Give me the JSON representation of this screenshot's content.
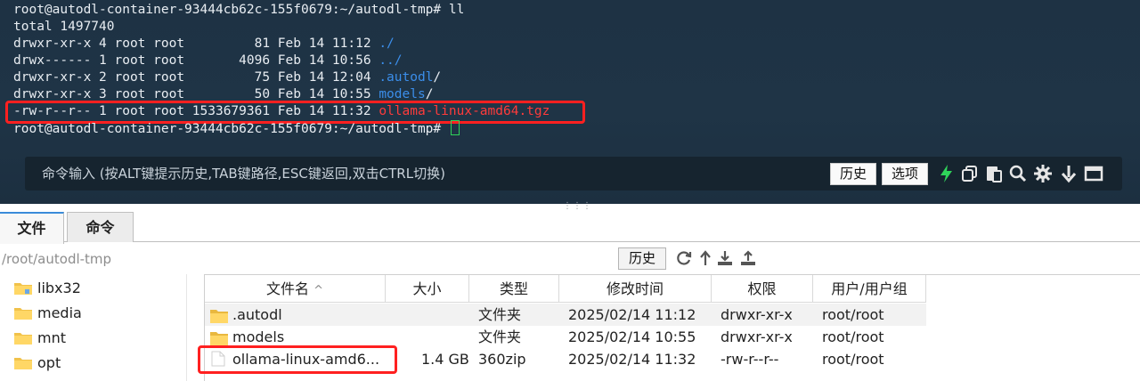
{
  "terminal": {
    "prompt": "root@autodl-container-93444cb62c-155f0679:~/autodl-tmp#",
    "command": "ll",
    "total": "total 1497740",
    "listing": [
      {
        "prefix": "drwxr-xr-x 4 root root         81 Feb 14 11:12 ",
        "name": "./",
        "kind": "dir"
      },
      {
        "prefix": "drwx------ 1 root root       4096 Feb 14 10:56 ",
        "name": "../",
        "kind": "dir"
      },
      {
        "prefix": "drwxr-xr-x 2 root root         75 Feb 14 12:04 ",
        "name": ".autodl",
        "suffix": "/",
        "kind": "dir"
      },
      {
        "prefix": "drwxr-xr-x 3 root root         50 Feb 14 10:55 ",
        "name": "models",
        "suffix": "/",
        "kind": "dir"
      },
      {
        "prefix": "-rw-r--r-- 1 root root 1533679361 Feb 14 11:32 ",
        "name": "ollama-linux-amd64.tgz",
        "kind": "archive"
      }
    ],
    "colors": {
      "dir": "#3b8eea",
      "archive": "#ff3b3b",
      "cursor": "#2fd45a",
      "highlight": "#ff2020"
    }
  },
  "command_bar": {
    "placeholder": "命令输入 (按ALT键提示历史,TAB键路径,ESC键返回,双击CTRL切换)",
    "history_label": "历史",
    "options_label": "选项",
    "icons": [
      "lightning-icon",
      "copy-icon",
      "paste-icon",
      "search-icon",
      "gear-icon",
      "download-arrow-icon",
      "maximize-icon"
    ]
  },
  "file_panel": {
    "tabs": [
      {
        "label": "文件",
        "active": true
      },
      {
        "label": "命令",
        "active": false
      }
    ],
    "path": "/root/autodl-tmp",
    "history_label": "历史",
    "path_icons": [
      "refresh-icon",
      "up-arrow-icon",
      "download-icon",
      "upload-icon"
    ],
    "tree": [
      "libx32",
      "media",
      "mnt",
      "opt"
    ],
    "table": {
      "headers": {
        "name": "文件名",
        "size": "大小",
        "type": "类型",
        "modified": "修改时间",
        "perm": "权限",
        "owner": "用户/用户组"
      },
      "sort_indicator": "^",
      "rows": [
        {
          "name": ".autodl",
          "size": "",
          "type": "文件夹",
          "modified": "2025/02/14 11:12",
          "perm": "drwxr-xr-x",
          "owner": "root/root",
          "icon": "folder-icon"
        },
        {
          "name": "models",
          "size": "",
          "type": "文件夹",
          "modified": "2025/02/14 10:55",
          "perm": "drwxr-xr-x",
          "owner": "root/root",
          "icon": "folder-icon"
        },
        {
          "name": "ollama-linux-amd6...",
          "size": "1.4 GB",
          "type": "360zip",
          "modified": "2025/02/14 11:32",
          "perm": "-rw-r--r--",
          "owner": "root/root",
          "icon": "file-icon"
        }
      ]
    }
  }
}
